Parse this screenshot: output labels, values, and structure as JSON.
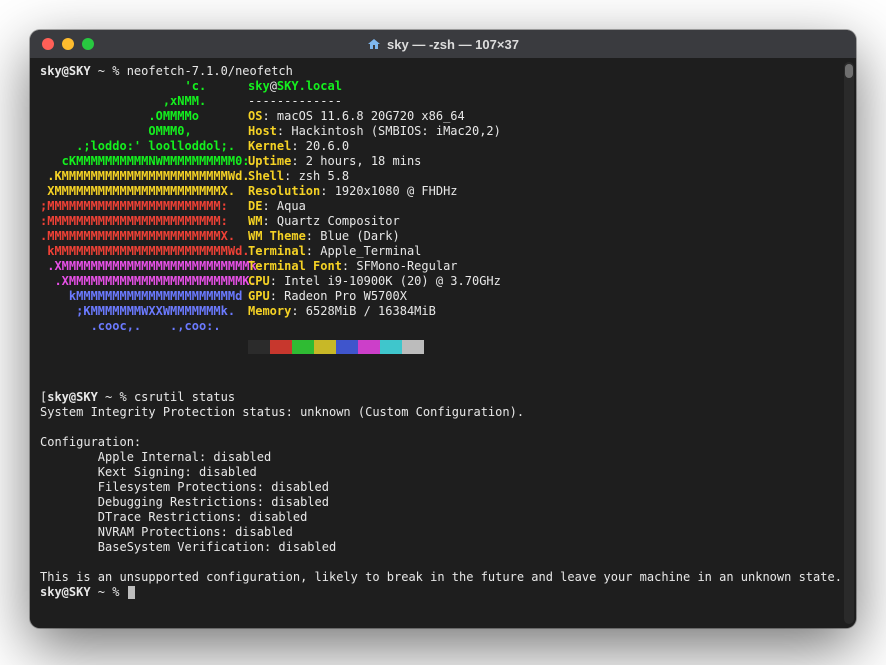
{
  "window": {
    "title": "sky — -zsh — 107×37"
  },
  "prompt1": {
    "user": "sky@SKY",
    "sep": " ~ % ",
    "cmd": "neofetch-7.1.0/neofetch"
  },
  "logo": [
    "                    'c.",
    "                 ,xNMM.",
    "               .OMMMMo",
    "               OMMM0,",
    "     .;loddo:' loolloddol;.",
    "   cKMMMMMMMMMMNWMMMMMMMMMM0:",
    " .KMMMMMMMMMMMMMMMMMMMMMMMWd.",
    " XMMMMMMMMMMMMMMMMMMMMMMMX.",
    ";MMMMMMMMMMMMMMMMMMMMMMMM:",
    ":MMMMMMMMMMMMMMMMMMMMMMMM:",
    ".MMMMMMMMMMMMMMMMMMMMMMMMX.",
    " kMMMMMMMMMMMMMMMMMMMMMMMMWd.",
    " .XMMMMMMMMMMMMMMMMMMMMMMMMMMk",
    "  .XMMMMMMMMMMMMMMMMMMMMMMMMK.",
    "    kMMMMMMMMMMMMMMMMMMMMMMd",
    "     ;KMMMMMMMWXXWMMMMMMMk.",
    "       .cooc,.    .,coo:."
  ],
  "header": {
    "user": "sky",
    "at": "@",
    "host": "SKY.local"
  },
  "dashes": "-------------",
  "info": [
    {
      "k": "OS",
      "v": "macOS 11.6.8 20G720 x86_64"
    },
    {
      "k": "Host",
      "v": "Hackintosh (SMBIOS: iMac20,2)"
    },
    {
      "k": "Kernel",
      "v": "20.6.0"
    },
    {
      "k": "Uptime",
      "v": "2 hours, 18 mins"
    },
    {
      "k": "Shell",
      "v": "zsh 5.8"
    },
    {
      "k": "Resolution",
      "v": "1920x1080 @ FHDHz"
    },
    {
      "k": "DE",
      "v": "Aqua"
    },
    {
      "k": "WM",
      "v": "Quartz Compositor"
    },
    {
      "k": "WM Theme",
      "v": "Blue (Dark)"
    },
    {
      "k": "Terminal",
      "v": "Apple_Terminal"
    },
    {
      "k": "Terminal Font",
      "v": "SFMono-Regular"
    },
    {
      "k": "CPU",
      "v": "Intel i9-10900K (20) @ 3.70GHz"
    },
    {
      "k": "GPU",
      "v": "Radeon Pro W5700X"
    },
    {
      "k": "Memory",
      "v": "6528MiB / 16384MiB"
    }
  ],
  "swatch_colors": [
    "#2b2b2b",
    "#c7372d",
    "#2fbb33",
    "#c8b827",
    "#3f55cc",
    "#cc3fc9",
    "#3fc6cc",
    "#bcbcbc"
  ],
  "prompt2": {
    "prefix": "[",
    "user": "sky@SKY",
    "sep": " ~ % ",
    "cmd": "csrutil status",
    "suffix": "]"
  },
  "sip_line": "System Integrity Protection status: unknown (Custom Configuration).",
  "config_header": "Configuration:",
  "config_lines": [
    "        Apple Internal: disabled",
    "        Kext Signing: disabled",
    "        Filesystem Protections: disabled",
    "        Debugging Restrictions: disabled",
    "        DTrace Restrictions: disabled",
    "        NVRAM Protections: disabled",
    "        BaseSystem Verification: disabled"
  ],
  "warning": "This is an unsupported configuration, likely to break in the future and leave your machine in an unknown state.",
  "prompt3": {
    "user": "sky@SKY",
    "sep": " ~ % "
  }
}
